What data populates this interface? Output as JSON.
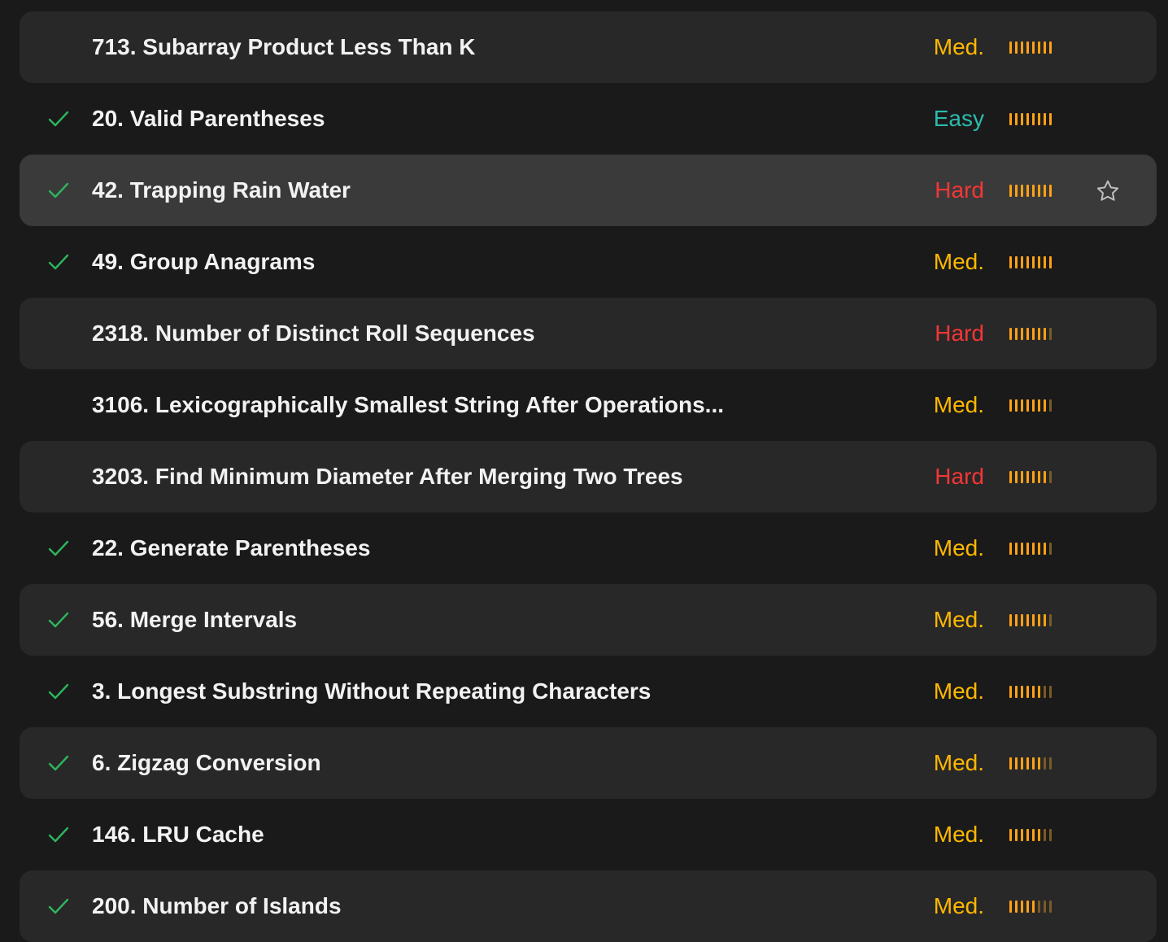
{
  "colors": {
    "easy": "#2cbbad",
    "medium": "#ffb800",
    "hard": "#f63636",
    "check": "#2db55d",
    "bar_active": "#ffa116",
    "bar_dim": "#7a5a26"
  },
  "problems": [
    {
      "title": "713. Subarray Product Less Than K",
      "difficulty": "Med.",
      "level": "medium",
      "solved": false,
      "frequency_bars": 8,
      "frequency_active": 8
    },
    {
      "title": "20. Valid Parentheses",
      "difficulty": "Easy",
      "level": "easy",
      "solved": true,
      "frequency_bars": 8,
      "frequency_active": 8
    },
    {
      "title": "42. Trapping Rain Water",
      "difficulty": "Hard",
      "level": "hard",
      "solved": true,
      "frequency_bars": 8,
      "frequency_active": 8,
      "hovered": true,
      "star_icon": "star-outline-icon"
    },
    {
      "title": "49. Group Anagrams",
      "difficulty": "Med.",
      "level": "medium",
      "solved": true,
      "frequency_bars": 8,
      "frequency_active": 8
    },
    {
      "title": "2318. Number of Distinct Roll Sequences",
      "difficulty": "Hard",
      "level": "hard",
      "solved": false,
      "frequency_bars": 8,
      "frequency_active": 7
    },
    {
      "title": "3106. Lexicographically Smallest String After Operations...",
      "difficulty": "Med.",
      "level": "medium",
      "solved": false,
      "frequency_bars": 8,
      "frequency_active": 7
    },
    {
      "title": "3203. Find Minimum Diameter After Merging Two Trees",
      "difficulty": "Hard",
      "level": "hard",
      "solved": false,
      "frequency_bars": 8,
      "frequency_active": 7
    },
    {
      "title": "22. Generate Parentheses",
      "difficulty": "Med.",
      "level": "medium",
      "solved": true,
      "frequency_bars": 8,
      "frequency_active": 7
    },
    {
      "title": "56. Merge Intervals",
      "difficulty": "Med.",
      "level": "medium",
      "solved": true,
      "frequency_bars": 8,
      "frequency_active": 7
    },
    {
      "title": "3. Longest Substring Without Repeating Characters",
      "difficulty": "Med.",
      "level": "medium",
      "solved": true,
      "frequency_bars": 8,
      "frequency_active": 6
    },
    {
      "title": "6. Zigzag Conversion",
      "difficulty": "Med.",
      "level": "medium",
      "solved": true,
      "frequency_bars": 8,
      "frequency_active": 6
    },
    {
      "title": "146. LRU Cache",
      "difficulty": "Med.",
      "level": "medium",
      "solved": true,
      "frequency_bars": 8,
      "frequency_active": 6
    },
    {
      "title": "200. Number of Islands",
      "difficulty": "Med.",
      "level": "medium",
      "solved": true,
      "frequency_bars": 8,
      "frequency_active": 5
    }
  ]
}
